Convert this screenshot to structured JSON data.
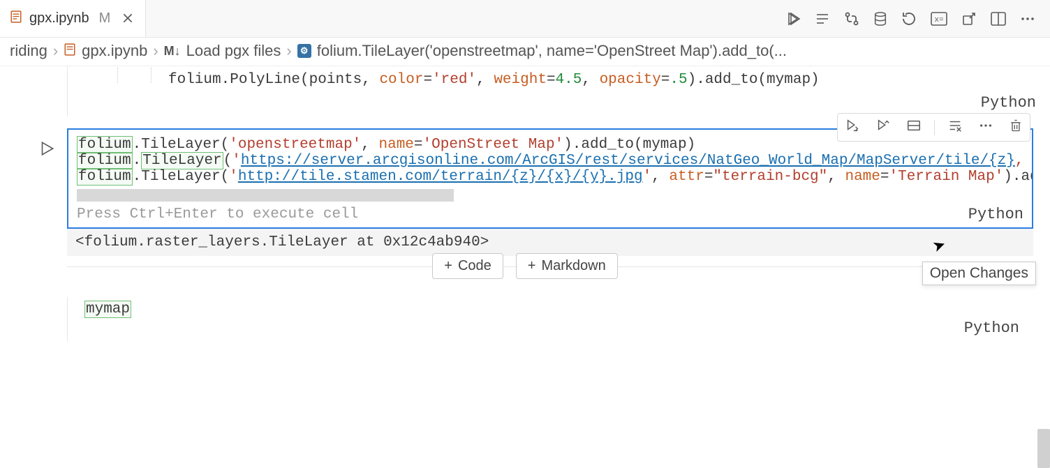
{
  "tab": {
    "filename": "gpx.ipynb",
    "modified_marker": "M"
  },
  "breadcrumbs": {
    "folder": "riding",
    "file": "gpx.ipynb",
    "section": "Load pgx files",
    "symbol": "folium.TileLayer('openstreetmap', name='OpenStreet Map').add_to(..."
  },
  "prev_cell": {
    "code_tokens": {
      "prefix": "folium.PolyLine(points, ",
      "color_kw": "color",
      "eq1": "=",
      "color_val": "'red'",
      "c1": ", ",
      "weight_kw": "weight",
      "eq2": "=",
      "weight_val": "4.5",
      "c2": ", ",
      "opacity_kw": "opacity",
      "eq3": "=",
      "opacity_val": ".5",
      "suffix": ").add_to(mymap)"
    },
    "lang": "Python"
  },
  "active_cell": {
    "line1": {
      "boxed": "folium",
      "rest1": ".TileLayer(",
      "str1": "'openstreetmap'",
      "c1": ", ",
      "kw1": "name",
      "eq1": "=",
      "str2": "'OpenStreet Map'",
      "rest2": ").add_to(mymap)"
    },
    "line2": {
      "boxed1": "folium",
      "dot": ".",
      "boxed2": "TileLayer",
      "rest1": "(",
      "str_q": "'",
      "url": "https://server.arcgisonline.com/ArcGIS/rest/services/NatGeo_World_Map/MapServer/tile/{z}",
      "trail": ","
    },
    "line3": {
      "boxed": "folium",
      "rest1": ".TileLayer(",
      "str_q": "'",
      "url": "http://tile.stamen.com/terrain/{z}/{x}/{y}.jpg",
      "str_q2": "'",
      "c1": ", ",
      "kw1": "attr",
      "eq1": "=",
      "str1": "\"terrain-bcg\"",
      "c2": ", ",
      "kw2": "name",
      "eq2": "=",
      "str2": "'Terrain Map'",
      "rest2": ").add_to(myma"
    },
    "hint": "Press Ctrl+Enter to execute cell",
    "lang": "Python"
  },
  "output": "<folium.raster_layers.TileLayer at 0x12c4ab940>",
  "add": {
    "code": "Code",
    "markdown": "Markdown"
  },
  "next_cell": {
    "boxed": "mymap",
    "lang": "Python"
  },
  "tooltip": "Open Changes"
}
